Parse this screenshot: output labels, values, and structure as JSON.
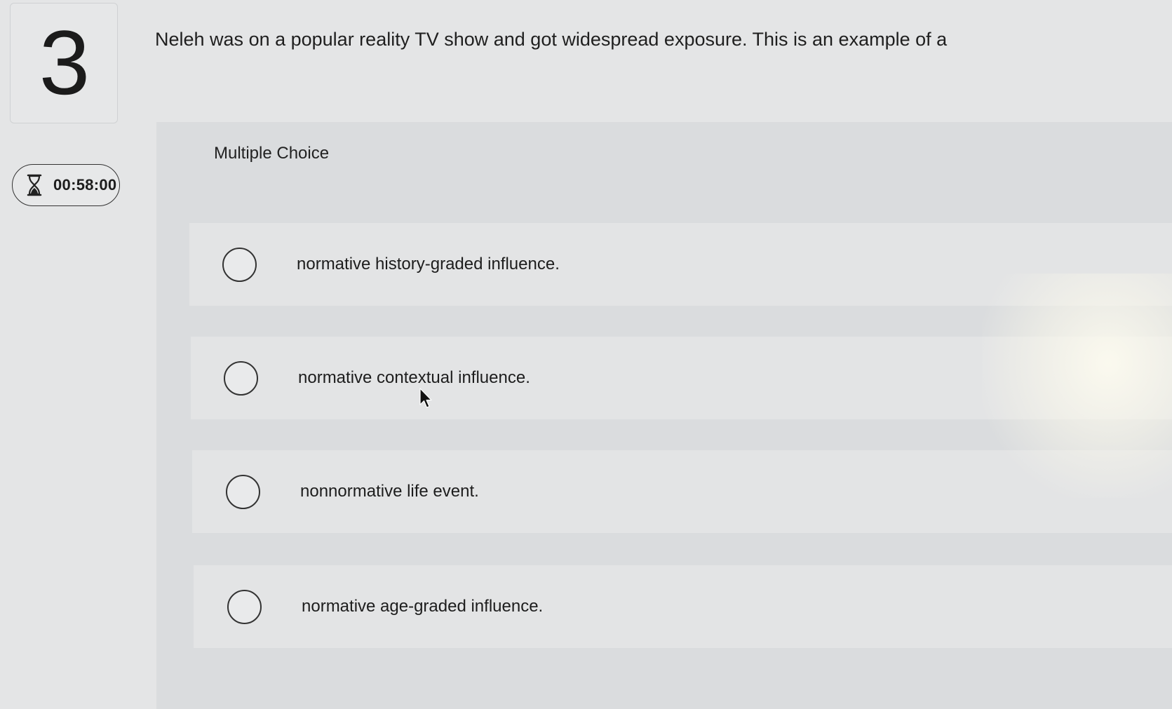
{
  "question": {
    "number": "3",
    "text": "Neleh was on a popular reality TV show and got widespread exposure. This is an example of a"
  },
  "timer": {
    "icon": "hourglass-icon",
    "value": "00:58:00"
  },
  "answer_section": {
    "type_label": "Multiple Choice",
    "options": [
      {
        "label": "normative history-graded influence."
      },
      {
        "label": "normative contextual influence."
      },
      {
        "label": "nonnormative life event."
      },
      {
        "label": "normative age-graded influence."
      }
    ]
  }
}
